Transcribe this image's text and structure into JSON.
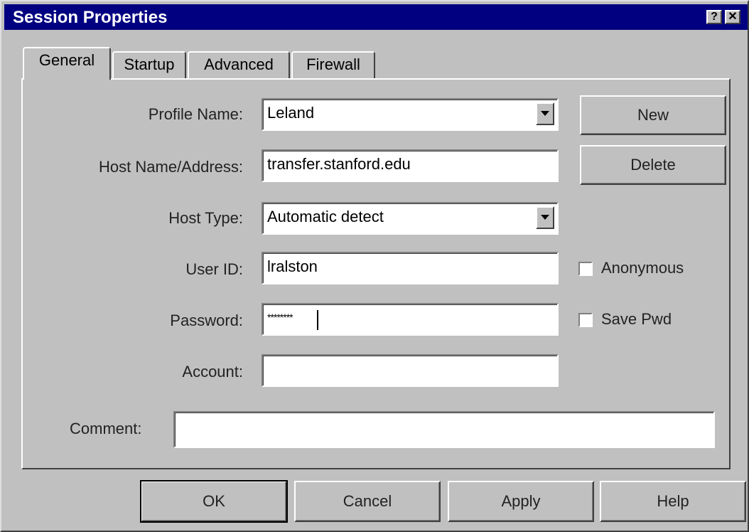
{
  "window": {
    "title": "Session Properties",
    "help_button": "?",
    "close_button": "✕"
  },
  "tabs": [
    {
      "label": "General",
      "active": true
    },
    {
      "label": "Startup",
      "active": false
    },
    {
      "label": "Advanced",
      "active": false
    },
    {
      "label": "Firewall",
      "active": false
    }
  ],
  "form": {
    "profile_name": {
      "label": "Profile Name:",
      "value": "Leland"
    },
    "host_name": {
      "label": "Host Name/Address:",
      "value": "transfer.stanford.edu"
    },
    "host_type": {
      "label": "Host Type:",
      "value": "Automatic detect"
    },
    "user_id": {
      "label": "User ID:",
      "value": "lralston"
    },
    "password": {
      "label": "Password:",
      "value": "********"
    },
    "account": {
      "label": "Account:",
      "value": ""
    },
    "comment": {
      "label": "Comment:",
      "value": ""
    }
  },
  "side_buttons": {
    "new": "New",
    "delete": "Delete"
  },
  "checkboxes": {
    "anonymous": {
      "label": "Anonymous",
      "checked": false
    },
    "save_pwd": {
      "label": "Save Pwd",
      "checked": false
    }
  },
  "footer_buttons": {
    "ok": "OK",
    "cancel": "Cancel",
    "apply": "Apply",
    "help": "Help"
  }
}
